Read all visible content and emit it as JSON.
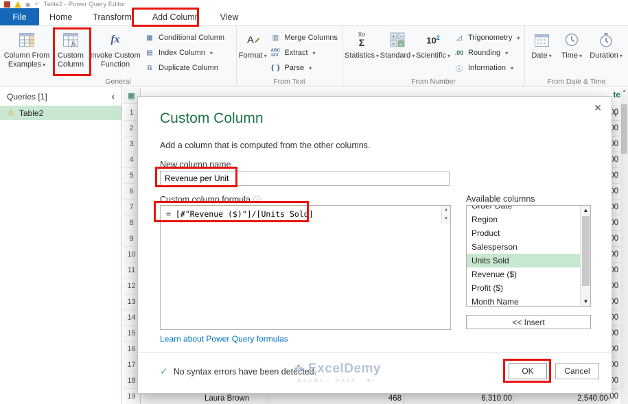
{
  "titlebar": {
    "title": "Table2 - Power Query Editor"
  },
  "tabs": {
    "file": "File",
    "home": "Home",
    "transform": "Transform",
    "add_column": "Add Column",
    "view": "View"
  },
  "ribbon": {
    "general": {
      "label": "General",
      "column_from_examples": "Column From Examples",
      "custom_column": "Custom Column",
      "invoke_custom_function": "Invoke Custom Function",
      "conditional_column": "Conditional Column",
      "index_column": "Index Column",
      "duplicate_column": "Duplicate Column"
    },
    "from_text": {
      "label": "From Text",
      "format": "Format",
      "merge_columns": "Merge Columns",
      "extract": "Extract",
      "parse": "Parse"
    },
    "from_number": {
      "label": "From Number",
      "statistics": "Statistics",
      "standard": "Standard",
      "scientific": "Scientific",
      "trigonometry": "Trigonometry",
      "rounding": "Rounding",
      "information": "Information"
    },
    "from_datetime": {
      "label": "From Date & Time",
      "date": "Date",
      "time": "Time",
      "duration": "Duration"
    }
  },
  "sidebar": {
    "header": "Queries [1]",
    "query_name": "Table2"
  },
  "grid": {
    "row_numbers": [
      "1",
      "2",
      "3",
      "4",
      "5",
      "6",
      "7",
      "8",
      "9",
      "10",
      "11",
      "12",
      "13",
      "14",
      "15",
      "16",
      "17",
      "18",
      "19"
    ],
    "right_cells": [
      ".00",
      ".00",
      ".00",
      ".00",
      ".00",
      ".00",
      ".00",
      ".00",
      ".00",
      ".00",
      ".00",
      ".00",
      ".00",
      ".00",
      ".00",
      ".00",
      ".00",
      ".00",
      ".00"
    ],
    "right_header_fragment": "te",
    "bottom_row": {
      "salesperson": "Laura Brown",
      "units": "468",
      "revenue": "6,310.00",
      "profit": "2,540.00"
    }
  },
  "dialog": {
    "title": "Custom Column",
    "subtitle": "Add a column that is computed from the other columns.",
    "name_label": "New column name",
    "name_value": "Revenue per Unit",
    "formula_label": "Custom column formula",
    "available_label": "Available columns",
    "formula_value": "= [#\"Revenue ($)\"]/[Units Sold]",
    "columns": [
      {
        "label": "Order Date"
      },
      {
        "label": "Region"
      },
      {
        "label": "Product"
      },
      {
        "label": "Salesperson"
      },
      {
        "label": "Units Sold",
        "selected": true
      },
      {
        "label": "Revenue ($)"
      },
      {
        "label": "Profit ($)"
      },
      {
        "label": "Month Name"
      }
    ],
    "insert_button": "<< Insert",
    "learn_link": "Learn about Power Query formulas",
    "status_text": "No syntax errors have been detected.",
    "ok": "OK",
    "cancel": "Cancel"
  },
  "watermark": {
    "name": "ExcelDemy",
    "tagline": "EXCEL · DATA · BI"
  }
}
